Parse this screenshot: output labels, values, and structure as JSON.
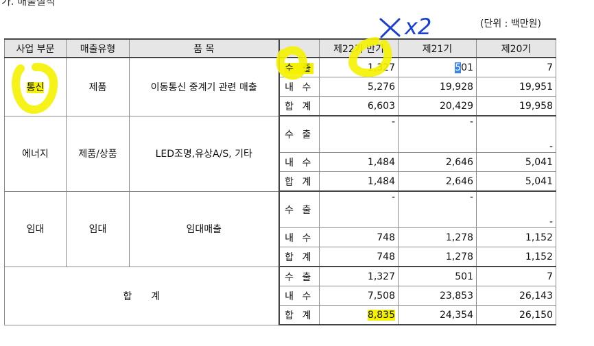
{
  "section_title": "가. 매출실적",
  "unit_label": "(단위 : 백만원)",
  "headers": {
    "division": "사업 부문",
    "type": "매출유형",
    "item": "품 목",
    "period_blank": "",
    "p22": "제22기 반기",
    "p21": "제21기",
    "p20": "제20기"
  },
  "row_labels": {
    "export": "수 출",
    "domestic": "내 수",
    "total": "합 계"
  },
  "groups": [
    {
      "division": "통신",
      "type": "제품",
      "item": "이동통신 중계기 관련 매출",
      "export": [
        "1,327",
        "5",
        "01",
        "7"
      ],
      "domestic": [
        "5,276",
        "19,928",
        "19,951"
      ],
      "total": [
        "6,603",
        "20,429",
        "19,958"
      ]
    },
    {
      "division": "에너지",
      "type": "제품/상품",
      "item": "LED조명,유상A/S, 기타",
      "export": [
        "-",
        "-",
        "-"
      ],
      "domestic": [
        "1,484",
        "2,646",
        "5,041"
      ],
      "total": [
        "1,484",
        "2,646",
        "5,041"
      ]
    },
    {
      "division": "임대",
      "type": "임대",
      "item": "임대매출",
      "export": [
        "-",
        "-",
        "-"
      ],
      "domestic": [
        "748",
        "1,278",
        "1,152"
      ],
      "total": [
        "748",
        "1,278",
        "1,152"
      ]
    }
  ],
  "grand_total": {
    "label": "합　　계",
    "export": [
      "1,327",
      "501",
      "7"
    ],
    "domestic": [
      "7,508",
      "23,853",
      "26,143"
    ],
    "total": [
      "8,835",
      "24,354",
      "26,150"
    ]
  },
  "annotations": {
    "handwritten_note": "x2",
    "highlight_color": "#f4f200",
    "selection_color": "#3a84e8",
    "ink_color": "#1a3fd6"
  }
}
